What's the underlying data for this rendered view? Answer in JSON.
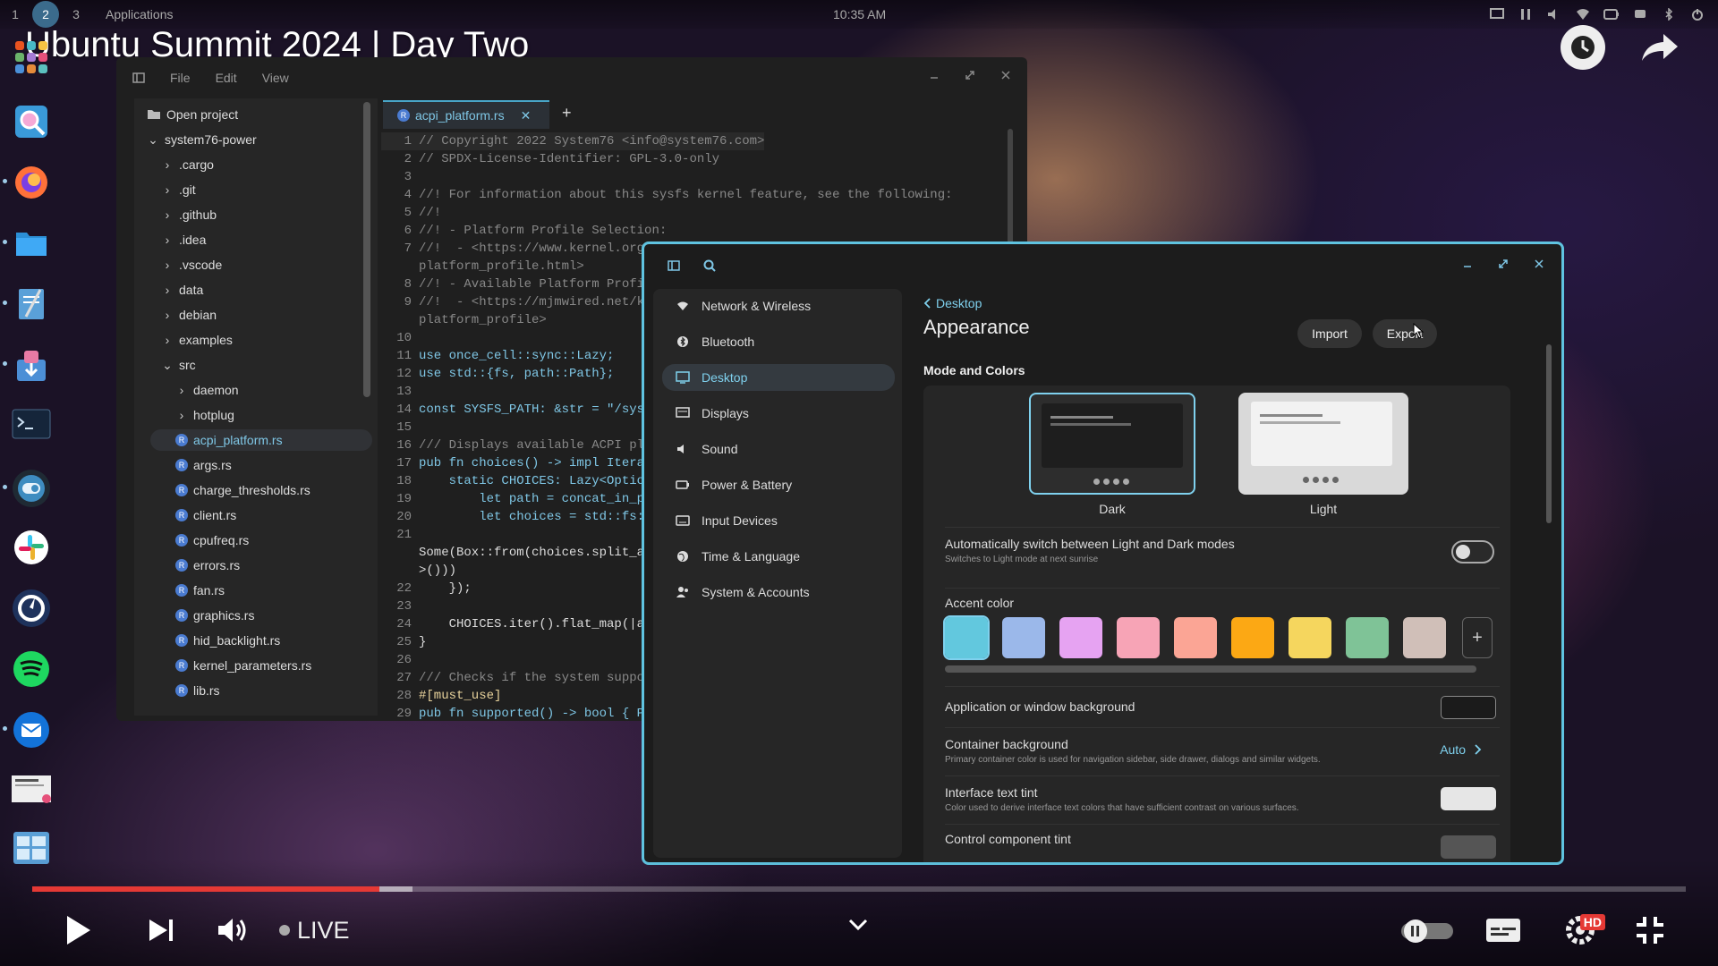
{
  "topbar": {
    "workspaces": [
      "1",
      "2",
      "3"
    ],
    "active_workspace": "2",
    "applications_label": "Applications",
    "clock": "10:35 AM",
    "tray_icons": [
      "screen-icon",
      "pause-icon",
      "volume-icon",
      "wifi-icon",
      "battery-icon",
      "notification-icon",
      "bluetooth-icon",
      "power-icon"
    ]
  },
  "video": {
    "title": "Ubuntu Summit 2024 | Day Two",
    "actions": [
      "watch-later-icon",
      "share-icon"
    ],
    "live_label": "LIVE",
    "progress": 0.21,
    "buffered": 0.23,
    "hd_badge": "HD"
  },
  "dock": {
    "apps": [
      "launcher-icon",
      "search-app-icon",
      "firefox-icon",
      "files-icon",
      "text-editor-icon",
      "store-icon",
      "terminal-icon",
      "settings-app-icon",
      "slack-icon",
      "mattermost-icon",
      "spotify-icon",
      "thunderbird-icon",
      "screenshot-icon",
      "workspaces-icon"
    ]
  },
  "editor": {
    "menu": [
      "File",
      "Edit",
      "View"
    ],
    "tab": {
      "label": "acpi_platform.rs",
      "add": "+"
    },
    "tree": {
      "open_project": "Open project",
      "root": "system76-power",
      "folders": [
        ".cargo",
        ".git",
        ".github",
        ".idea",
        ".vscode",
        "data",
        "debian",
        "examples"
      ],
      "src": "src",
      "src_folders": [
        "daemon",
        "hotplug"
      ],
      "files": [
        "acpi_platform.rs",
        "args.rs",
        "charge_thresholds.rs",
        "client.rs",
        "cpufreq.rs",
        "errors.rs",
        "fan.rs",
        "graphics.rs",
        "hid_backlight.rs",
        "kernel_parameters.rs",
        "lib.rs"
      ],
      "selected_file": "acpi_platform.rs"
    },
    "code": [
      {
        "n": "1",
        "t": "// Copyright 2022 System76 <info@system76.com>"
      },
      {
        "n": "2",
        "t": "// SPDX-License-Identifier: GPL-3.0-only"
      },
      {
        "n": "3",
        "t": ""
      },
      {
        "n": "4",
        "t": "//! For information about this sysfs kernel feature, see the following:"
      },
      {
        "n": "5",
        "t": "//!"
      },
      {
        "n": "6",
        "t": "//! - Platform Profile Selection:"
      },
      {
        "n": "7",
        "t": "//!  - <https://www.kernel.org/doc/html/latest/userspace-api/sysfs-"
      },
      {
        "n": "",
        "t": "platform_profile.html>"
      },
      {
        "n": "8",
        "t": "//! - Available Platform Profile"
      },
      {
        "n": "9",
        "t": "//!  - <https://mjmwired.net/ke"
      },
      {
        "n": "",
        "t": "platform_profile>"
      },
      {
        "n": "10",
        "t": ""
      },
      {
        "n": "11",
        "t": "use once_cell::sync::Lazy;"
      },
      {
        "n": "12",
        "t": "use std::{fs, path::Path};"
      },
      {
        "n": "13",
        "t": ""
      },
      {
        "n": "14",
        "t": "const SYSFS_PATH: &str = \"/sys/"
      },
      {
        "n": "15",
        "t": ""
      },
      {
        "n": "16",
        "t": "/// Displays available ACPI pla"
      },
      {
        "n": "17",
        "t": "pub fn choices() -> impl Iterat"
      },
      {
        "n": "18",
        "t": "    static CHOICES: Lazy<Option"
      },
      {
        "n": "19",
        "t": "        let path = concat_in_pl"
      },
      {
        "n": "20",
        "t": "        let choices = std::fs::"
      },
      {
        "n": "21",
        "t": ""
      },
      {
        "n": "",
        "t": "Some(Box::from(choices.split_as"
      },
      {
        "n": "",
        "t": ">()))"
      },
      {
        "n": "22",
        "t": "    });"
      },
      {
        "n": "23",
        "t": ""
      },
      {
        "n": "24",
        "t": "    CHOICES.iter().flat_map(|ar"
      },
      {
        "n": "25",
        "t": "}"
      },
      {
        "n": "26",
        "t": ""
      },
      {
        "n": "27",
        "t": "/// Checks if the system suppor"
      },
      {
        "n": "28",
        "t": "#[must_use]"
      },
      {
        "n": "29",
        "t": "pub fn supported() -> bool { Pa"
      }
    ]
  },
  "settings": {
    "nav": [
      {
        "label": "Network & Wireless",
        "icon": "wifi-icon"
      },
      {
        "label": "Bluetooth",
        "icon": "bluetooth-icon"
      },
      {
        "label": "Desktop",
        "icon": "desktop-icon"
      },
      {
        "label": "Displays",
        "icon": "display-icon"
      },
      {
        "label": "Sound",
        "icon": "speaker-icon"
      },
      {
        "label": "Power & Battery",
        "icon": "battery-icon"
      },
      {
        "label": "Input Devices",
        "icon": "keyboard-icon"
      },
      {
        "label": "Time & Language",
        "icon": "globe-icon"
      },
      {
        "label": "System & Accounts",
        "icon": "users-icon"
      }
    ],
    "selected_nav": "Desktop",
    "breadcrumb": "Desktop",
    "page_title": "Appearance",
    "import_label": "Import",
    "export_label": "Export",
    "section_title": "Mode and Colors",
    "modes": [
      {
        "label": "Dark",
        "selected": true
      },
      {
        "label": "Light",
        "selected": false
      }
    ],
    "auto_switch": {
      "title": "Automatically switch between Light and Dark modes",
      "subtitle": "Switches to Light mode at next sunrise",
      "on": false
    },
    "accent_label": "Accent color",
    "accent_colors": [
      "#62c8de",
      "#9bb8ea",
      "#e6a3f2",
      "#f7a4b6",
      "#fba595",
      "#fca814",
      "#f5d65e",
      "#7fc397",
      "#d0bfb8"
    ],
    "add_color": "+",
    "app_bg": {
      "title": "Application or window background",
      "color": "#1b1b1b"
    },
    "container_bg": {
      "title": "Container background",
      "subtitle": "Primary container color is used for navigation sidebar, side drawer, dialogs and similar widgets.",
      "value": "Auto"
    },
    "text_tint": {
      "title": "Interface text tint",
      "subtitle": "Color used to derive interface text colors that have sufficient contrast on various surfaces.",
      "color": "#e6e6e6"
    },
    "control_tint": {
      "title": "Control component tint"
    }
  }
}
